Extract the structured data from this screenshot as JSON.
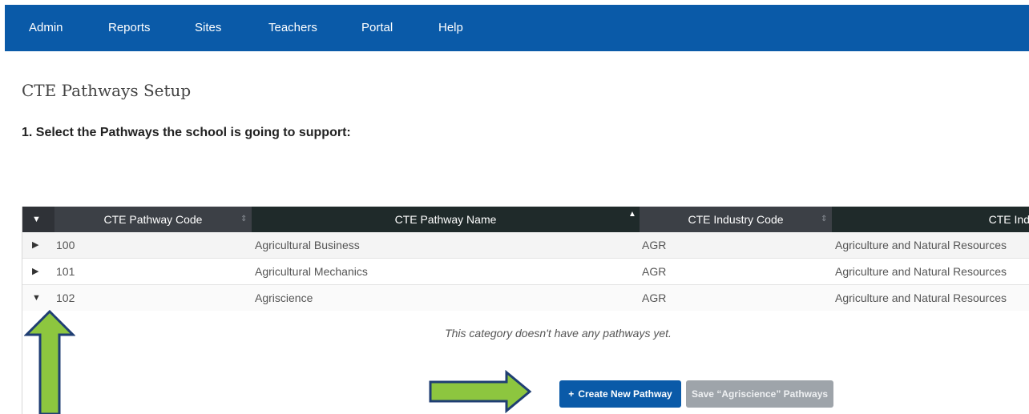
{
  "nav": {
    "items": [
      "Admin",
      "Reports",
      "Sites",
      "Teachers",
      "Portal",
      "Help"
    ],
    "bg_color": "#0a5aa8"
  },
  "page": {
    "title": "CTE Pathways Setup",
    "step_heading": "1. Select the Pathways the school is going to support:"
  },
  "grid": {
    "columns": [
      {
        "label": "CTE Pathway Code"
      },
      {
        "label": "CTE Pathway Name"
      },
      {
        "label": "CTE Industry Code"
      },
      {
        "label": "CTE Ind"
      }
    ],
    "rows": [
      {
        "code": "100",
        "name": "Agricultural Business",
        "industry_code": "AGR",
        "industry_name": "Agriculture and Natural Resources",
        "expanded": false
      },
      {
        "code": "101",
        "name": "Agricultural Mechanics",
        "industry_code": "AGR",
        "industry_name": "Agriculture and Natural Resources",
        "expanded": false
      },
      {
        "code": "102",
        "name": "Agriscience",
        "industry_code": "AGR",
        "industry_name": "Agriculture and Natural Resources",
        "expanded": true
      }
    ],
    "empty_message": "This category doesn't have any pathways yet.",
    "create_button_label": "Create New Pathway",
    "save_button_label": "Save “Agriscience” Pathways"
  },
  "icons": {
    "collapse_all": "caret-down-icon",
    "sort": "sort-icon",
    "expand": "caret-right-icon",
    "collapse": "caret-down-icon",
    "plus": "plus-icon",
    "annotation_arrows": "green-arrow-icon"
  },
  "colors": {
    "header_bg": "#2f3237",
    "primary_button": "#0a5aa8",
    "disabled_button": "#9ea4aa",
    "annotation_green": "#8dc63f",
    "annotation_outline": "#1f3e73"
  }
}
